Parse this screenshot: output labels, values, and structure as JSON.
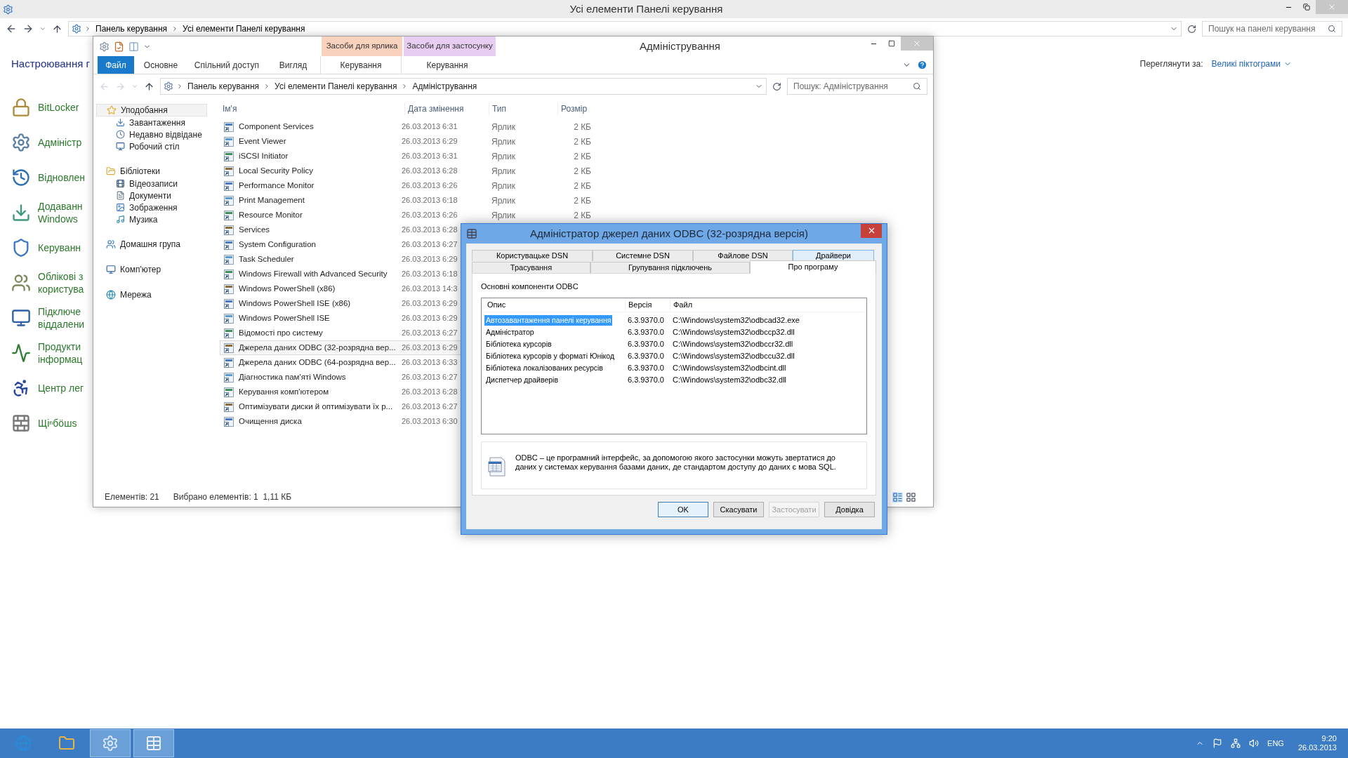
{
  "main_window": {
    "title": "Усі елементи Панелі керування",
    "address": [
      "Панель керування",
      "Усі елементи Панелі керування"
    ],
    "search": {
      "placeholder": "Пошук на панелі керування"
    },
    "heading": "Настроювання г",
    "view_by": {
      "label": "Переглянути за:",
      "value": "Великі піктограми"
    },
    "items": [
      {
        "lines": [
          "BitLocker"
        ]
      },
      {
        "lines": [
          "Адміністр"
        ]
      },
      {
        "lines": [
          "Відновлен"
        ]
      },
      {
        "lines": [
          "Додаванн",
          "Windows"
        ]
      },
      {
        "lines": [
          "Керуванн"
        ]
      },
      {
        "lines": [
          "Облікові з",
          "користува"
        ]
      },
      {
        "lines": [
          "Підключе",
          "віддалени"
        ]
      },
      {
        "lines": [
          "Продукти",
          "інформац"
        ]
      },
      {
        "lines": [
          "Центр лег"
        ]
      },
      {
        "lines": [
          "Щіⁿбöшs"
        ]
      }
    ]
  },
  "explorer": {
    "title": "Адміністрування",
    "context_tabs": [
      {
        "label": "Засоби для ярлика",
        "color": "#f8d2bd"
      },
      {
        "label": "Засоби для застосунку",
        "color": "#e7cdf2"
      }
    ],
    "ribbon_tabs": [
      {
        "label": "Файл",
        "kind": "file"
      },
      {
        "label": "Основне",
        "kind": "tab"
      },
      {
        "label": "Спільний доступ",
        "kind": "tab"
      },
      {
        "label": "Вигляд",
        "kind": "tab"
      },
      {
        "label": "Керування",
        "kind": "context"
      },
      {
        "label": "Керування",
        "kind": "context"
      }
    ],
    "address": [
      "Панель керування",
      "Усі елементи Панелі керування",
      "Адміністрування"
    ],
    "search": {
      "placeholder": "Пошук: Адміністрування"
    },
    "nav": [
      {
        "label": "Уподобання",
        "selected": true,
        "children": [
          {
            "label": "Завантаження",
            "selected": false
          },
          {
            "label": "Недавно відвідане",
            "selected": false
          },
          {
            "label": "Робочий стіл",
            "selected": false
          }
        ]
      },
      {
        "label": "Бібліотеки",
        "selected": false,
        "children": [
          {
            "label": "Відеозаписи",
            "selected": false
          },
          {
            "label": "Документи",
            "selected": false
          },
          {
            "label": "Зображення",
            "selected": false
          },
          {
            "label": "Музика",
            "selected": false
          }
        ]
      },
      {
        "label": "Домашня група",
        "selected": false
      },
      {
        "label": "Комп'ютер",
        "selected": false
      },
      {
        "label": "Мережа",
        "selected": false
      }
    ],
    "columns": [
      "Ім'я",
      "Дата змінення",
      "Тип",
      "Розмір"
    ],
    "rows": [
      {
        "name": "Component Services",
        "date": "26.03.2013 6:31",
        "type": "Ярлик",
        "size": "2 КБ",
        "selected": false
      },
      {
        "name": "Event Viewer",
        "date": "26.03.2013 6:29",
        "type": "Ярлик",
        "size": "2 КБ",
        "selected": false
      },
      {
        "name": "iSCSI Initiator",
        "date": "26.03.2013 6:31",
        "type": "Ярлик",
        "size": "2 КБ",
        "selected": false
      },
      {
        "name": "Local Security Policy",
        "date": "26.03.2013 6:28",
        "type": "Ярлик",
        "size": "2 КБ",
        "selected": false
      },
      {
        "name": "Performance Monitor",
        "date": "26.03.2013 6:26",
        "type": "Ярлик",
        "size": "2 КБ",
        "selected": false
      },
      {
        "name": "Print Management",
        "date": "26.03.2013 6:18",
        "type": "Ярлик",
        "size": "2 КБ",
        "selected": false
      },
      {
        "name": "Resource Monitor",
        "date": "26.03.2013 6:26",
        "type": "Ярлик",
        "size": "2 КБ",
        "selected": false
      },
      {
        "name": "Services",
        "date": "26.03.2013 6:28",
        "selected": false
      },
      {
        "name": "System Configuration",
        "date": "26.03.2013 6:27",
        "selected": false
      },
      {
        "name": "Task Scheduler",
        "date": "26.03.2013 6:29",
        "selected": false
      },
      {
        "name": "Windows Firewall with Advanced Security",
        "date": "26.03.2013 6:18",
        "selected": false
      },
      {
        "name": "Windows PowerShell (x86)",
        "date": "26.03.2013 14:3",
        "selected": false
      },
      {
        "name": "Windows PowerShell ISE (x86)",
        "date": "26.03.2013 6:29",
        "selected": false
      },
      {
        "name": "Windows PowerShell ISE",
        "date": "26.03.2013 6:29",
        "selected": false
      },
      {
        "name": "Відомості про систему",
        "date": "26.03.2013 6:27",
        "selected": false
      },
      {
        "name": "Джерела даних ODBC (32-розрядна вер...",
        "date": "26.03.2013 6:29",
        "selected": true
      },
      {
        "name": "Джерела даних ODBC (64-розрядна вер...",
        "date": "26.03.2013 6:33",
        "selected": false
      },
      {
        "name": "Діагностика пам'яті Windows",
        "date": "26.03.2013 6:27",
        "selected": false
      },
      {
        "name": "Керування комп'ютером",
        "date": "26.03.2013 6:28",
        "selected": false
      },
      {
        "name": "Оптимізувати диски й оптимізувати їх р...",
        "date": "26.03.2013 6:27",
        "selected": false
      },
      {
        "name": "Очищення диска",
        "date": "26.03.2013 6:30",
        "selected": false
      }
    ],
    "status": {
      "count": "Елементів: 21",
      "selection": "Вибрано елементів: 1  1,11 КБ"
    }
  },
  "dialog": {
    "title": "Адміністратор джерел даних ODBC (32-розрядна версія)",
    "tab_rows": [
      [
        {
          "label": "Користувацьке DSN",
          "selected": false,
          "hovered": false
        },
        {
          "label": "Системне DSN",
          "selected": false,
          "hovered": false
        },
        {
          "label": "Файлове DSN",
          "selected": false,
          "hovered": false
        },
        {
          "label": "Драйвери",
          "selected": false,
          "hovered": true
        }
      ],
      [
        {
          "label": "Трасування",
          "selected": false,
          "hovered": false
        },
        {
          "label": "Групування підключень",
          "selected": false,
          "hovered": false
        },
        {
          "label": "Про програму",
          "selected": true,
          "hovered": false
        }
      ]
    ],
    "group_label": "Основні компоненти ODBC",
    "columns": [
      "Опис",
      "Версія",
      "Файл"
    ],
    "rows": [
      {
        "cells": [
          "Автозавантаження панелі керування",
          "6.3.9370.0",
          "C:\\Windows\\system32\\odbcad32.exe"
        ],
        "selected": true
      },
      {
        "cells": [
          "Адміністратор",
          "6.3.9370.0",
          "C:\\Windows\\system32\\odbccp32.dll"
        ],
        "selected": false
      },
      {
        "cells": [
          "Бібліотека курсорів",
          "6.3.9370.0",
          "C:\\Windows\\system32\\odbccr32.dll"
        ],
        "selected": false
      },
      {
        "cells": [
          "Бібліотека курсорів у форматі Юнікод",
          "6.3.9370.0",
          "C:\\Windows\\system32\\odbccu32.dll"
        ],
        "selected": false
      },
      {
        "cells": [
          "Бібліотека локалізованих ресурсів",
          "6.3.9370.0",
          "C:\\Windows\\system32\\odbcint.dll"
        ],
        "selected": false
      },
      {
        "cells": [
          "Диспетчер драйверів",
          "6.3.9370.0",
          "C:\\Windows\\system32\\odbc32.dll"
        ],
        "selected": false
      }
    ],
    "info": "ODBC – це програмний інтерфейс, за допомогою якого застосунки можуть звертатися до даних у системах керування базами даних, де стандартом доступу до даних є мова SQL.",
    "buttons": [
      {
        "label": "OK",
        "kind": "default",
        "disabled": false
      },
      {
        "label": "Скасувати",
        "kind": "normal",
        "disabled": false
      },
      {
        "label": "Застосувати",
        "kind": "normal",
        "disabled": true
      },
      {
        "label": "Довідка",
        "kind": "normal",
        "disabled": false
      }
    ]
  },
  "taskbar": {
    "apps": [
      {
        "active": false
      },
      {
        "active": false
      },
      {
        "active": true
      },
      {
        "active": true
      }
    ],
    "tray": {
      "language": "ENG",
      "time": "9:20",
      "date": "26.03.2013"
    }
  }
}
